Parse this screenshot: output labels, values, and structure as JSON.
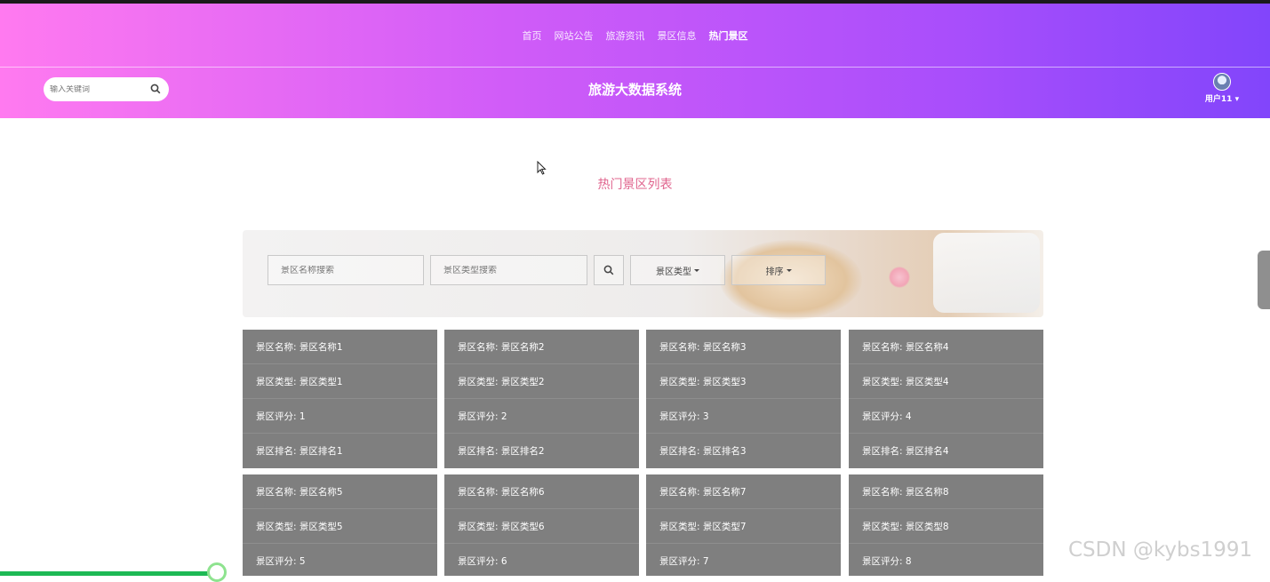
{
  "nav": {
    "items": [
      {
        "label": "首页"
      },
      {
        "label": "网站公告"
      },
      {
        "label": "旅游资讯"
      },
      {
        "label": "景区信息"
      },
      {
        "label": "热门景区",
        "active": true
      }
    ]
  },
  "header": {
    "search_placeholder": "输入关键词",
    "site_title": "旅游大数据系统",
    "username": "用户11"
  },
  "main": {
    "list_title": "热门景区列表",
    "filters": {
      "name_placeholder": "景区名称搜索",
      "type_placeholder": "景区类型搜索",
      "type_dropdown_label": "景区类型",
      "sort_dropdown_label": "排序"
    },
    "cards": [
      {
        "name": "景区名称: 景区名称1",
        "type": "景区类型: 景区类型1",
        "score": "景区评分: 1",
        "rank": "景区排名: 景区排名1"
      },
      {
        "name": "景区名称: 景区名称2",
        "type": "景区类型: 景区类型2",
        "score": "景区评分: 2",
        "rank": "景区排名: 景区排名2"
      },
      {
        "name": "景区名称: 景区名称3",
        "type": "景区类型: 景区类型3",
        "score": "景区评分: 3",
        "rank": "景区排名: 景区排名3"
      },
      {
        "name": "景区名称: 景区名称4",
        "type": "景区类型: 景区类型4",
        "score": "景区评分: 4",
        "rank": "景区排名: 景区排名4"
      },
      {
        "name": "景区名称: 景区名称5",
        "type": "景区类型: 景区类型5",
        "score": "景区评分: 5"
      },
      {
        "name": "景区名称: 景区名称6",
        "type": "景区类型: 景区类型6",
        "score": "景区评分: 6"
      },
      {
        "name": "景区名称: 景区名称7",
        "type": "景区类型: 景区类型7",
        "score": "景区评分: 7"
      },
      {
        "name": "景区名称: 景区名称8",
        "type": "景区类型: 景区类型8",
        "score": "景区评分: 8"
      }
    ]
  },
  "overlay": {
    "watermark": "CSDN @kybs1991"
  },
  "colors": {
    "header_gradient_start": "#ff7af0",
    "header_gradient_end": "#8245fb",
    "list_title": "#e0648e",
    "card_bg": "#7f7f7f",
    "progress": "#1db954"
  },
  "icons": [
    "search-icon",
    "caret-down-icon",
    "avatar",
    "cursor-icon"
  ]
}
